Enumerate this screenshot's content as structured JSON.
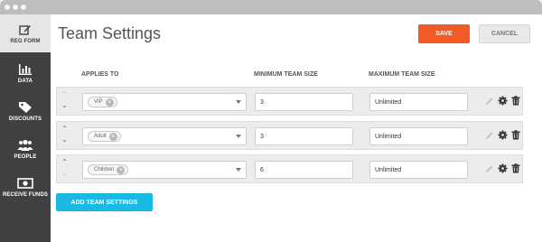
{
  "sidebar": {
    "items": [
      {
        "label": "REG FORM",
        "icon": "edit-icon"
      },
      {
        "label": "DATA",
        "icon": "bar-chart-icon"
      },
      {
        "label": "DISCOUNTS",
        "icon": "tag-icon"
      },
      {
        "label": "PEOPLE",
        "icon": "people-icon"
      },
      {
        "label": "RECEIVE FUNDS",
        "icon": "money-icon"
      }
    ]
  },
  "header": {
    "title": "Team Settings",
    "save_label": "SAVE",
    "cancel_label": "CANCEL"
  },
  "table": {
    "columns": [
      "APPLIES TO",
      "MINIMUM TEAM SIZE",
      "MAXIMUM TEAM SIZE"
    ],
    "rows": [
      {
        "tag": "VIP",
        "min": "3",
        "max": "Unlimited"
      },
      {
        "tag": "Adult",
        "min": "3",
        "max": "Unlimited"
      },
      {
        "tag": "Children",
        "min": "6",
        "max": "Unlimited"
      }
    ]
  },
  "add_button_label": "ADD TEAM SETTINGS",
  "colors": {
    "save": "#f15a24",
    "add": "#19b9e4",
    "sidebar": "#3f4141"
  }
}
